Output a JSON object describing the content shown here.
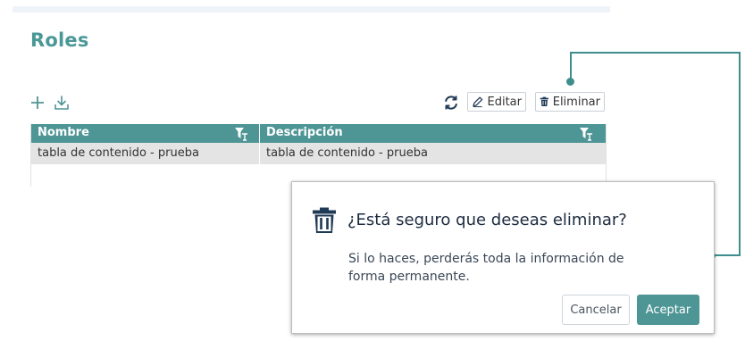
{
  "page": {
    "title": "Roles"
  },
  "toolbar": {
    "add_icon": "plus-icon",
    "download_icon": "download-icon",
    "refresh_icon": "refresh-icon",
    "edit_label": "Editar",
    "delete_label": "Eliminar"
  },
  "table": {
    "columns": [
      "Nombre",
      "Descripción"
    ],
    "rows": [
      [
        "tabla de contenido - prueba",
        "tabla de contenido - prueba"
      ]
    ]
  },
  "dialog": {
    "title": "¿Está seguro que deseas eliminar?",
    "message": "Si lo haces, perderás toda la información de forma permanente.",
    "cancel_label": "Cancelar",
    "accept_label": "Aceptar"
  },
  "colors": {
    "accent": "#4e9595",
    "title": "#4a9897",
    "dialog_title": "#1d2b3f"
  }
}
